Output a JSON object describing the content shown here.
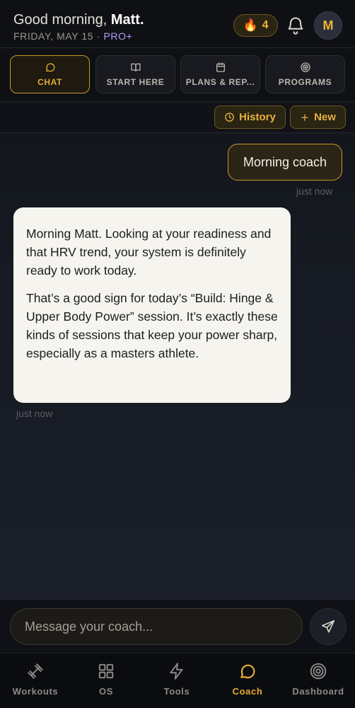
{
  "header": {
    "greeting_prefix": "Good morning,",
    "user_name": "Matt.",
    "date": "FRIDAY, MAY 15",
    "separator": "·",
    "plan": "PRO+",
    "streak_count": "4",
    "avatar_initial": "M"
  },
  "tabs": [
    {
      "label": "CHAT",
      "icon": "chat-bubble-icon",
      "active": true
    },
    {
      "label": "START HERE",
      "icon": "book-icon",
      "active": false
    },
    {
      "label": "PLANS & REP...",
      "icon": "calendar-icon",
      "active": false
    },
    {
      "label": "PROGRAMS",
      "icon": "target-icon",
      "active": false
    }
  ],
  "actions": {
    "history_label": "History",
    "new_label": "New"
  },
  "messages": [
    {
      "role": "user",
      "text": "Morning coach",
      "time": "just now"
    },
    {
      "role": "coach",
      "paragraphs": [
        "Morning Matt. Looking at your readiness and that HRV trend, your system is definitely ready to work today.",
        "That’s a good sign for today’s “Build: Hinge & Upper Body Power” session. It’s exactly these kinds of sessions that keep your power sharp, especially as a masters athlete."
      ],
      "time": "just now"
    }
  ],
  "composer": {
    "placeholder": "Message your coach..."
  },
  "bottom_nav": [
    {
      "label": "Workouts",
      "icon": "dumbbell-icon",
      "active": false
    },
    {
      "label": "OS",
      "icon": "grid-icon",
      "active": false
    },
    {
      "label": "Tools",
      "icon": "lightning-icon",
      "active": false
    },
    {
      "label": "Coach",
      "icon": "chat-bubble-icon",
      "active": true
    },
    {
      "label": "Dashboard",
      "icon": "target-icon",
      "active": false
    }
  ],
  "colors": {
    "accent": "#e2ad38",
    "plan": "#b79cf5",
    "background": "#111318"
  }
}
